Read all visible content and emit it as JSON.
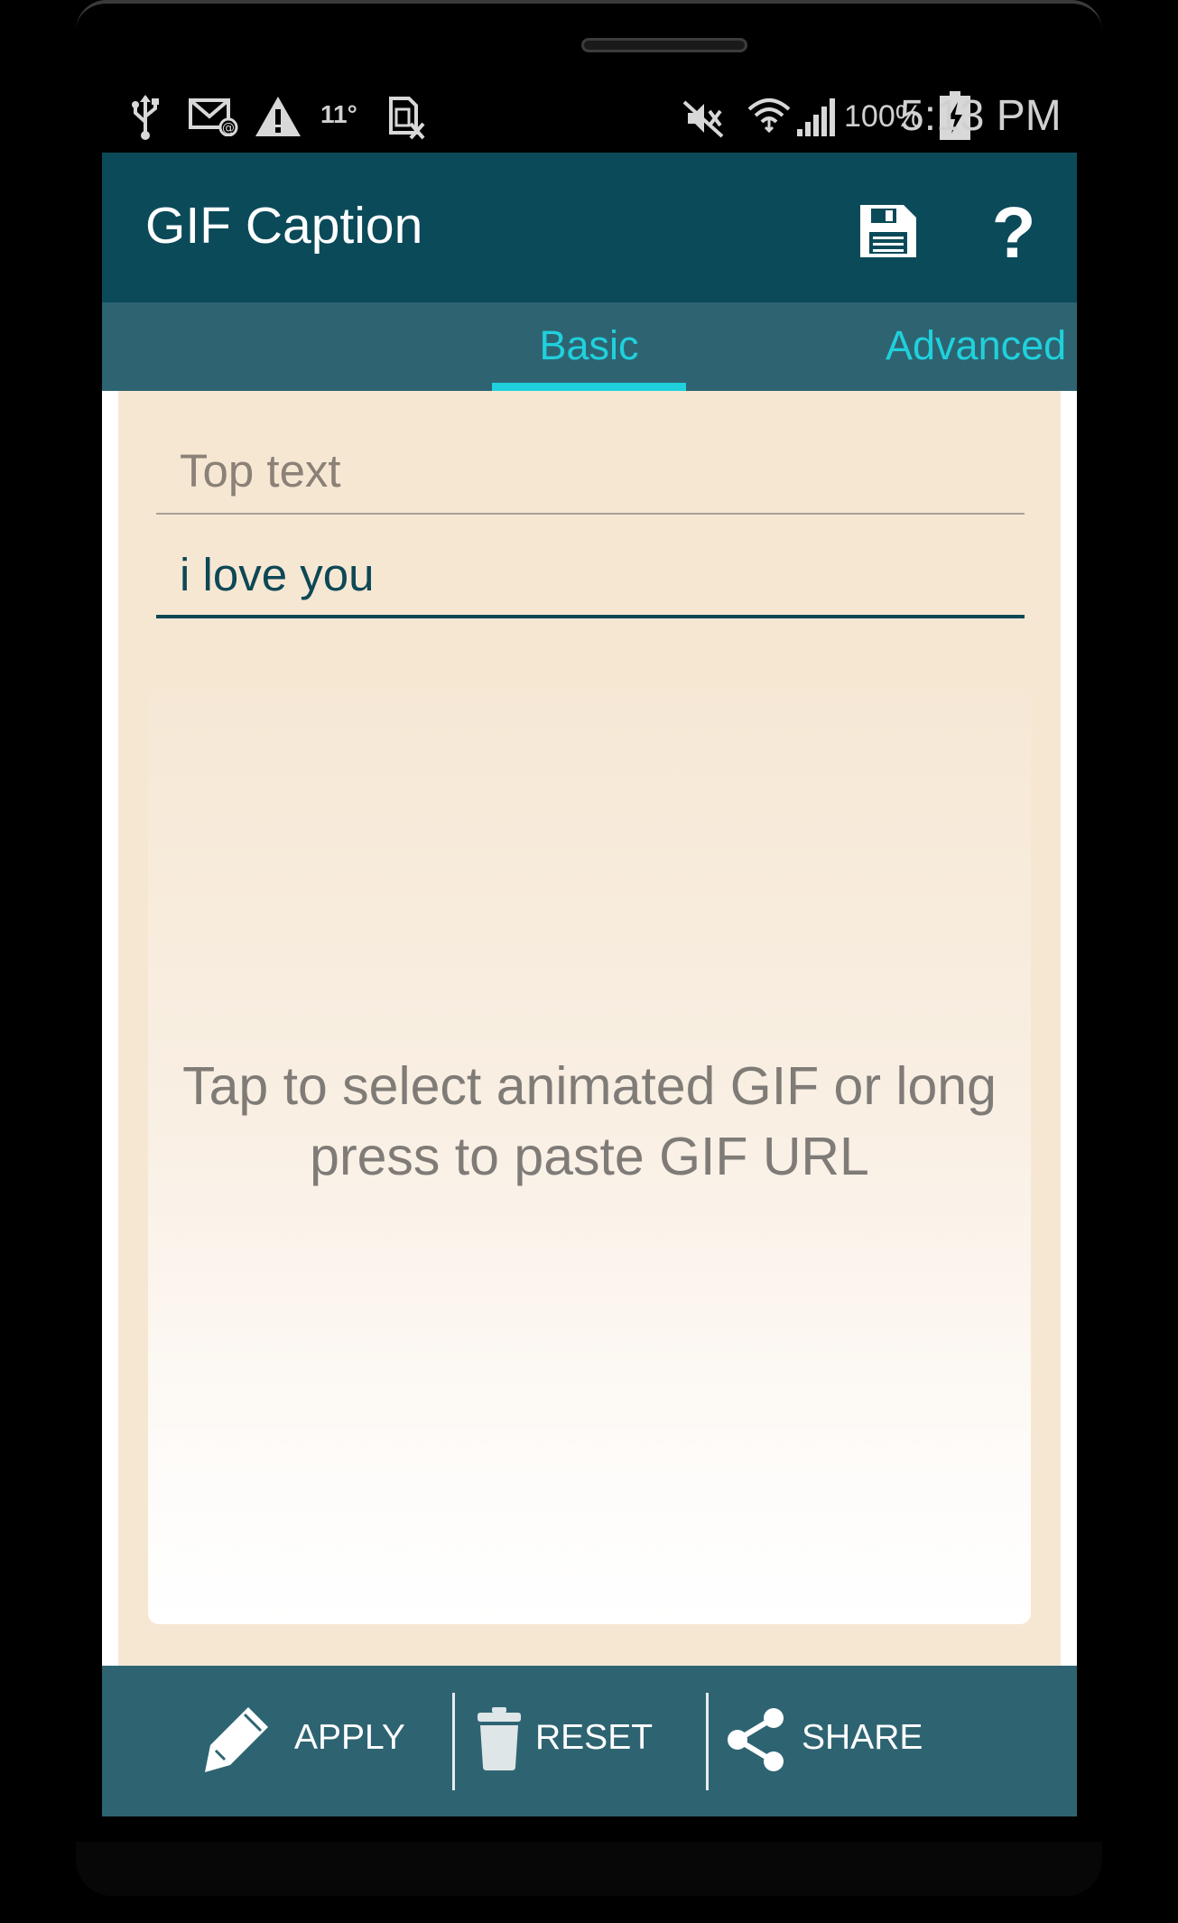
{
  "status_bar": {
    "temperature": "11°",
    "battery_percent": "100%",
    "time": "5:13 PM",
    "icons": [
      "usb-icon",
      "email-notification-icon",
      "warning-icon",
      "temperature",
      "sim-card-error-icon",
      "mute-icon",
      "wifi-icon",
      "signal-icon",
      "battery-charging-icon"
    ]
  },
  "app_bar": {
    "title": "GIF Caption",
    "actions": [
      "save-icon",
      "help-icon"
    ]
  },
  "tabs": [
    {
      "label": "Basic",
      "selected": true
    },
    {
      "label": "Advanced",
      "selected": false
    }
  ],
  "form": {
    "top_text": {
      "placeholder": "Top text",
      "value": ""
    },
    "bottom_text": {
      "placeholder": "",
      "value": "i love you"
    }
  },
  "gif_panel": {
    "hint": "Tap to select animated GIF or long press to paste GIF URL"
  },
  "bottom_bar": {
    "apply": "APPLY",
    "reset": "RESET",
    "share": "SHARE"
  },
  "colors": {
    "app_bar": "#0b4a59",
    "tab_bar": "#2e6472",
    "tab_accent": "#1fd1dc",
    "content_bg": "#f6e7d3"
  }
}
